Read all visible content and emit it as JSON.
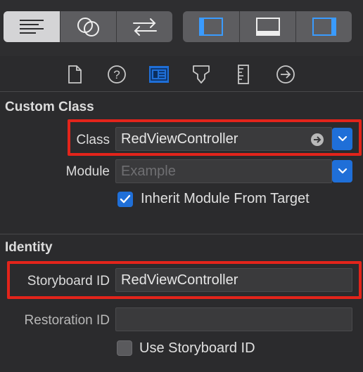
{
  "toolbar": {
    "left_group": [
      "lines-icon",
      "circles-icon",
      "arrows-icon"
    ],
    "right_group": [
      "left-panel-icon",
      "bottom-panel-icon",
      "right-panel-icon"
    ]
  },
  "inspector_tabs": [
    "file-icon",
    "help-icon",
    "identity-icon",
    "attributes-icon",
    "size-icon",
    "connections-icon"
  ],
  "custom_class": {
    "title": "Custom Class",
    "class_label": "Class",
    "class_value": "RedViewController",
    "module_label": "Module",
    "module_placeholder": "Example",
    "inherit_label": "Inherit Module From Target",
    "inherit_checked": true
  },
  "identity": {
    "title": "Identity",
    "storyboard_id_label": "Storyboard ID",
    "storyboard_id_value": "RedViewController",
    "restoration_id_label": "Restoration ID",
    "restoration_id_value": "",
    "use_storyboard_label": "Use Storyboard ID",
    "use_storyboard_checked": false
  },
  "colors": {
    "accent": "#1f6fd8",
    "highlight": "#e3241b",
    "background": "#2b2b2d"
  }
}
